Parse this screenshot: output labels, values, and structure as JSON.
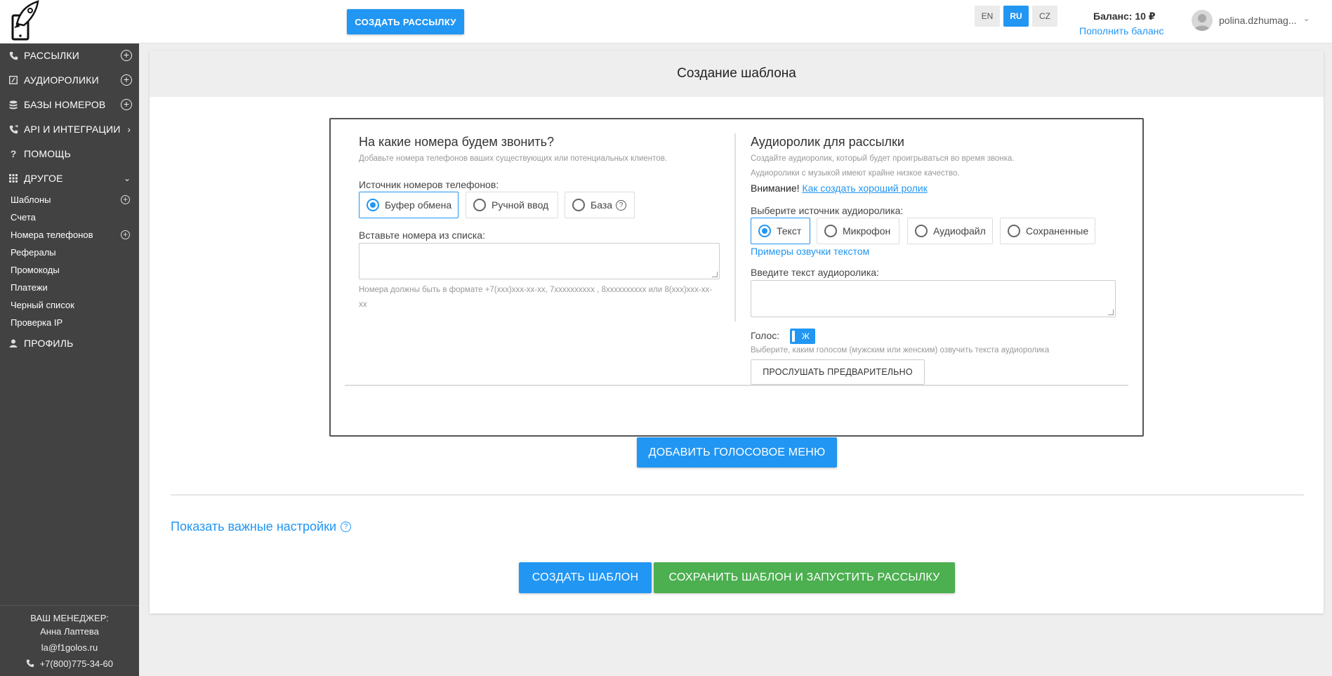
{
  "header": {
    "create_button": "СОЗДАТЬ РАССЫЛКУ",
    "languages": [
      {
        "code": "EN",
        "active": false
      },
      {
        "code": "RU",
        "active": true
      },
      {
        "code": "CZ",
        "active": false
      }
    ],
    "balance": "Баланс: 10 ₽",
    "topup": "Пополнить баланс",
    "username": "polina.dzhumag...",
    "accent": "#2196f3"
  },
  "sidebar": {
    "items": [
      {
        "label": "РАССЫЛКИ",
        "icon": "phone-icon"
      },
      {
        "label": "АУДИОРОЛИКИ",
        "icon": "audio-icon"
      },
      {
        "label": "БАЗЫ НОМЕРОВ",
        "icon": "database-icon"
      },
      {
        "label": "API И ИНТЕГРАЦИИ",
        "icon": "phone-forward-icon"
      },
      {
        "label": "ПОМОЩЬ",
        "icon": "help-icon"
      },
      {
        "label": "ДРУГОЕ",
        "icon": "grid-icon"
      },
      {
        "label": "ПРОФИЛЬ",
        "icon": "user-icon"
      }
    ],
    "subitems": [
      {
        "label": "Шаблоны"
      },
      {
        "label": "Счета"
      },
      {
        "label": "Номера телефонов"
      },
      {
        "label": "Рефералы"
      },
      {
        "label": "Промокоды"
      },
      {
        "label": "Платежи"
      },
      {
        "label": "Черный список"
      },
      {
        "label": "Проверка IP"
      }
    ],
    "manager": {
      "title": "ВАШ МЕНЕДЖЕР:",
      "name": "Анна Лаптева",
      "email": "la@f1golos.ru",
      "phone": "+7(800)775-34-60"
    }
  },
  "main": {
    "title": "Создание шаблона",
    "numbers": {
      "heading": "На какие номера будем звонить?",
      "hint": "Добавьте номера телефонов ваших существующих или потенциальных клиентов.",
      "source_label": "Источник номеров телефонов:",
      "sources": [
        "Буфер обмена",
        "Ручной ввод",
        "База"
      ],
      "selected_source": "Буфер обмена",
      "paste_label": "Вставьте номера из списка:",
      "paste_value": "",
      "format_hint": "Номера должны быть в формате +7(xxx)xxx-xx-xx, 7xxxxxxxxxx , 8xxxxxxxxxx или 8(xxx)xxx-xx-xx"
    },
    "audio": {
      "heading": "Аудиоролик для рассылки",
      "hint1": "Создайте аудиоролик, который будет проигрываться во время звонка.",
      "hint2": "Аудиоролики с музыкой имеют крайне низкое качество.",
      "attention": "Внимание!",
      "attention_link": "Как создать хороший ролик",
      "source_label": "Выберите источник аудиоролика:",
      "sources": [
        "Текст",
        "Микрофон",
        "Аудиофайл",
        "Сохраненные"
      ],
      "selected_source": "Текст",
      "examples_link": "Примеры озвучки текстом",
      "text_label": "Введите текст аудиоролика:",
      "text_value": "",
      "voice_label": "Голос:",
      "voice_value": "Ж",
      "voice_hint": "Выберите, каким голосом (мужским или женским) озвучить текста аудиоролика",
      "preview_button": "ПРОСЛУШАТЬ ПРЕДВАРИТЕЛЬНО"
    },
    "add_voice_menu": "ДОБАВИТЬ ГОЛОСОВОЕ МЕНЮ",
    "advanced_link": "Показать важные настройки",
    "create_template": "СОЗДАТЬ ШАБЛОН",
    "save_and_start": "СОХРАНИТЬ ШАБЛОН И ЗАПУСТИТЬ РАССЫЛКУ",
    "green": "#4caf50"
  }
}
